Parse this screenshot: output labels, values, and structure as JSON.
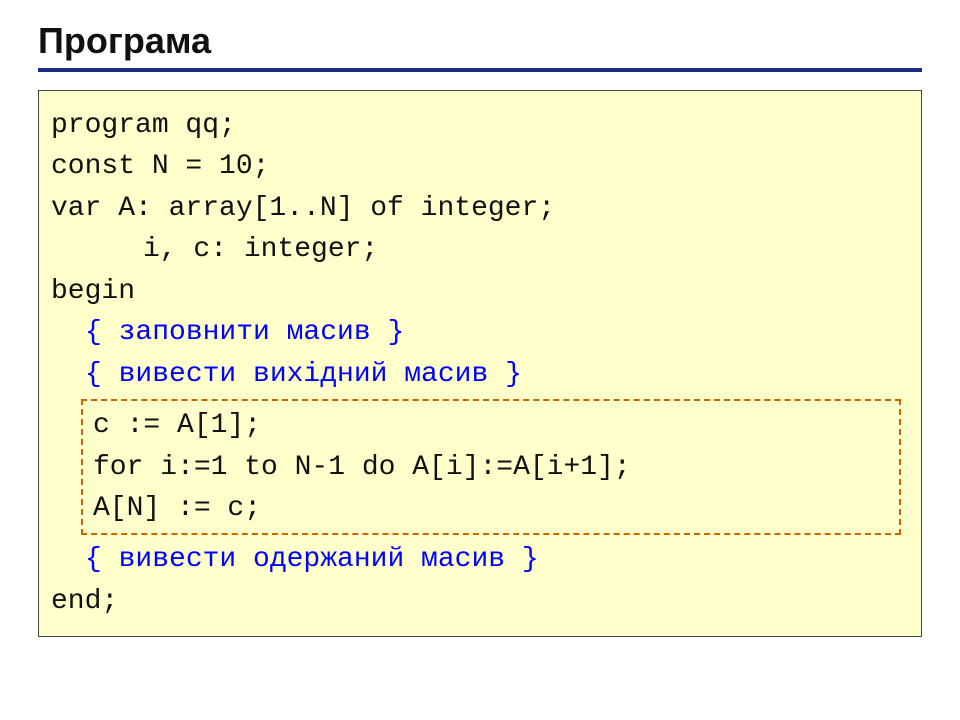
{
  "title": "Програма",
  "code": {
    "l1": "program qq;",
    "l2": "const N = 10;",
    "l3": "var A: array[1..N] of integer;",
    "l4": "i, c: integer;",
    "l5": "begin",
    "c1": "{ заповнити масив }",
    "c2": "{ вивести вихідний масив }",
    "d1": "c := A[1];",
    "d2": "for i:=1 to N-1 do A[i]:=A[i+1];",
    "d3": "A[N] := c;",
    "c3": "{ вивести одержаний масив }",
    "l6": "end;"
  }
}
